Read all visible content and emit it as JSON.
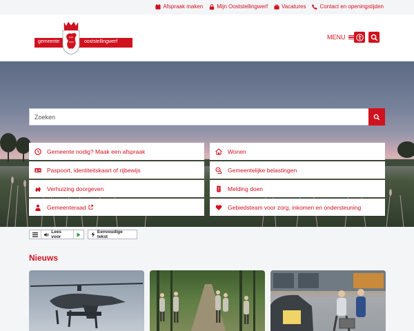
{
  "topbar": {
    "links": [
      {
        "label": "Afspraak maken",
        "icon": "calendar-icon"
      },
      {
        "label": "Mijn Ooststellingwerf",
        "icon": "lock-icon"
      },
      {
        "label": "Vacatures",
        "icon": "briefcase-icon"
      },
      {
        "label": "Contact en openingstijden",
        "icon": "phone-icon"
      }
    ]
  },
  "header": {
    "logo_left": "gemeente",
    "logo_right": "ooststellingwerf",
    "menu_label": "MENU"
  },
  "search": {
    "placeholder": "Zoeken"
  },
  "tiles": {
    "left": [
      {
        "label": "Gemeente nodig? Maak een afspraak",
        "icon": "clock-icon"
      },
      {
        "label": "Paspoort, identiteitskaart of rijbewijs",
        "icon": "id-card-icon"
      },
      {
        "label": "Verhuizing doorgeven",
        "icon": "truck-icon"
      },
      {
        "label": "Gemeenteraad",
        "icon": "person-icon"
      }
    ],
    "right": [
      {
        "label": "Wonen",
        "icon": "house-icon"
      },
      {
        "label": "Gemeentelijke belastingen",
        "icon": "tax-icon"
      },
      {
        "label": "Melding doen",
        "icon": "phone-report-icon"
      },
      {
        "label": "Gebiedsteam voor zorg, inkomen en ondersteuning",
        "icon": "heart-icon"
      }
    ]
  },
  "readspeaker": {
    "listen_label": "Lees voor",
    "easy_text_label": "Eenvoudige tekst"
  },
  "news": {
    "title": "Nieuws"
  },
  "colors": {
    "brand_red": "#d0121f"
  }
}
